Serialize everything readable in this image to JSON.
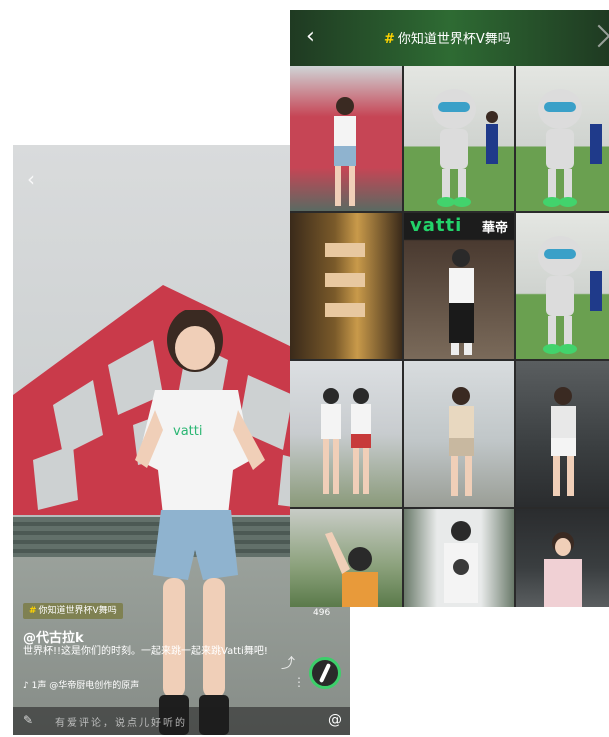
{
  "video": {
    "tag": "你知道世界杯V舞吗",
    "author": "@代古拉k",
    "caption": "世界杯!!这是你们的时刻。一起来跳一起来跳Vatti舞吧!",
    "music_icon": "music-note-icon",
    "music": "1声  @华帝厨电创作的原声",
    "count": "496",
    "comment_placeholder": "有爱评论，说点儿好听的",
    "record_color": "#3ccf6a"
  },
  "topic": {
    "title": "你知道世界杯V舞吗",
    "accent": "#ffd400",
    "header_color": "#2e6b33"
  },
  "grid": {
    "brand_text": "vatti",
    "brand_cn": "華帝"
  }
}
